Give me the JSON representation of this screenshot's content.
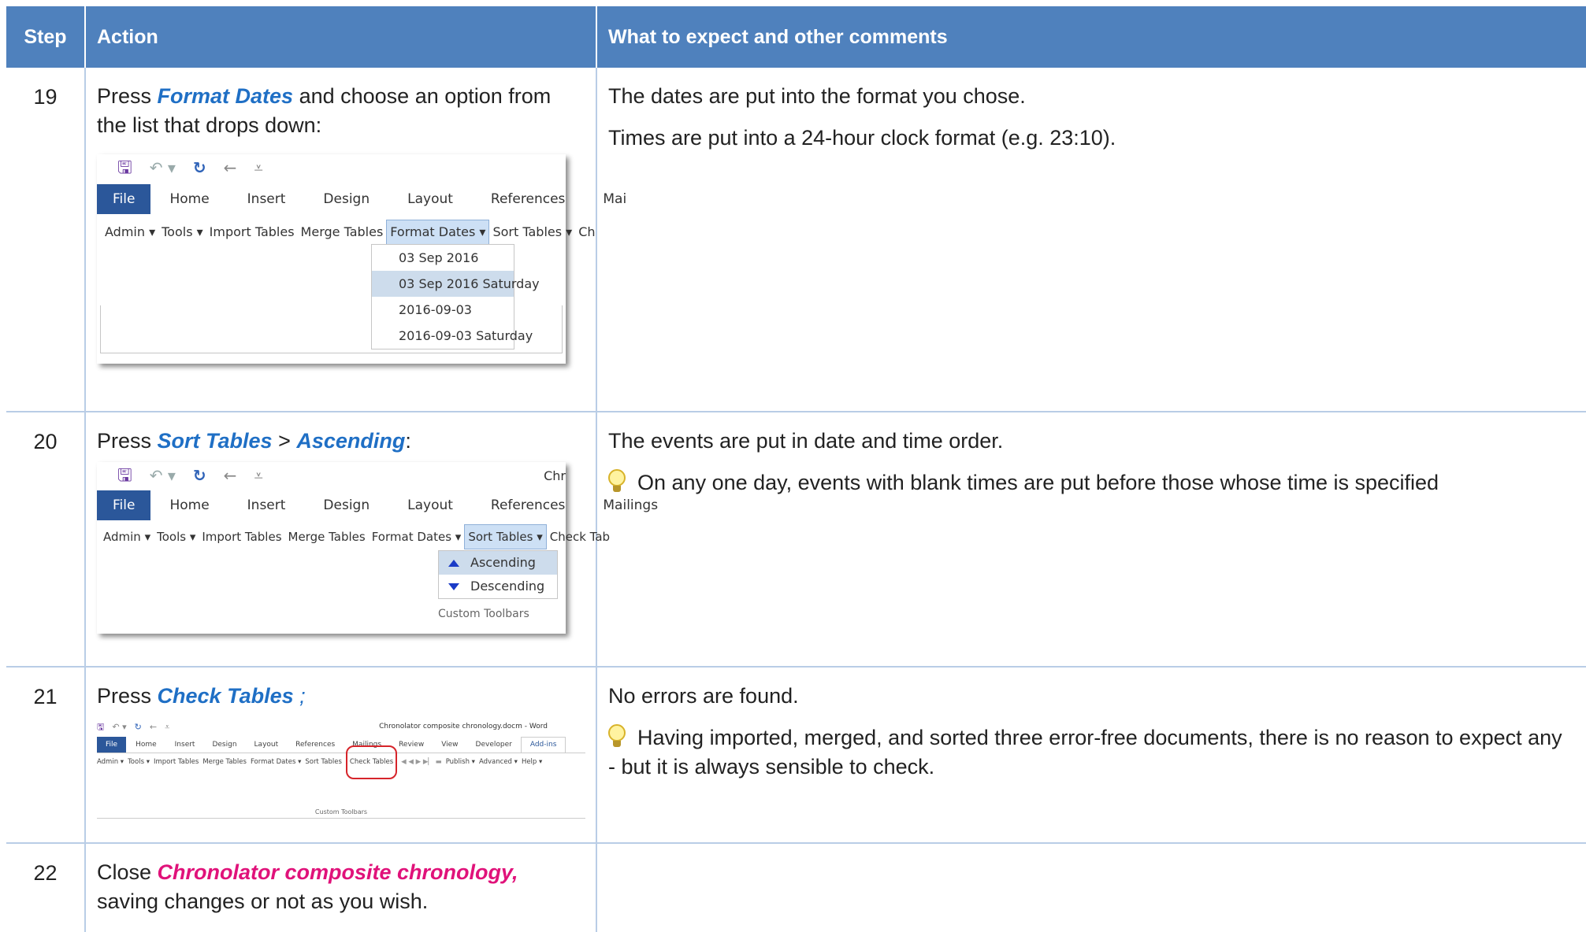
{
  "header": {
    "step": "Step",
    "action": "Action",
    "comments": "What to expect and other comments"
  },
  "rows": [
    {
      "step": "19",
      "action_pre": "Press ",
      "action_em": "Format Dates",
      "action_post": "  and choose an option from the list that drops down:",
      "comments": [
        "The dates are put into the format you chose.",
        "Times are put into a 24-hour clock format (e.g. 23:10)."
      ],
      "shot": {
        "tabs": [
          "File",
          "Home",
          "Insert",
          "Design",
          "Layout",
          "References",
          "Mai"
        ],
        "toolbar": [
          "Admin ▾",
          "Tools ▾",
          "Import Tables",
          "Merge Tables",
          "Format Dates ▾",
          "Sort Tables ▾",
          "Ch"
        ],
        "menu": [
          "03 Sep 2016",
          "03 Sep 2016 Saturday",
          "2016-09-03",
          "2016-09-03 Saturday"
        ],
        "menu_highlighted": "03 Sep 2016 Saturday"
      }
    },
    {
      "step": "20",
      "action_pre": "Press ",
      "action_em": "Sort Tables",
      "action_mid": " > ",
      "action_em2": "Ascending",
      "action_post": ":",
      "comments": [
        "The events are put in date and time order."
      ],
      "tip": "On any one day, events with blank times are put before those whose time is specified",
      "shot": {
        "title_fragment": "Chr",
        "tabs": [
          "File",
          "Home",
          "Insert",
          "Design",
          "Layout",
          "References",
          "Mailings"
        ],
        "toolbar": [
          "Admin ▾",
          "Tools ▾",
          "Import Tables",
          "Merge Tables",
          "Format Dates ▾",
          "Sort Tables ▾",
          "Check Tab"
        ],
        "menu": [
          "Ascending",
          "Descending"
        ],
        "group_label": "Custom Toolbars"
      }
    },
    {
      "step": "21",
      "action_pre": "Press ",
      "action_em": "Check Tables",
      "action_post": " ;",
      "comments": [
        "No errors are found."
      ],
      "tip": "Having imported, merged, and sorted three error-free documents, there is no reason to expect any - but it is always sensible to check.",
      "shot": {
        "title": "Chronolator composite chronology.docm - Word",
        "tabs": [
          "File",
          "Home",
          "Insert",
          "Design",
          "Layout",
          "References",
          "Mailings",
          "Review",
          "View",
          "Developer",
          "Add-ins"
        ],
        "toolbar": [
          "Admin ▾",
          "Tools ▾",
          "Import Tables",
          "Merge Tables",
          "Format Dates ▾",
          "Sort Tables",
          "Check Tables",
          "Publish ▾",
          "Advanced ▾",
          "Help ▾"
        ],
        "group_label": "Custom Toolbars"
      }
    },
    {
      "step": "22",
      "action_pre": "Close ",
      "action_em": "Chronolator composite chronology,",
      "action_post": "saving changes or not as you wish."
    }
  ],
  "colors": {
    "header_bg": "#4f81bd",
    "accent": "#1f6fc5",
    "pink": "#e0127a",
    "grid": "#b9cde6"
  }
}
